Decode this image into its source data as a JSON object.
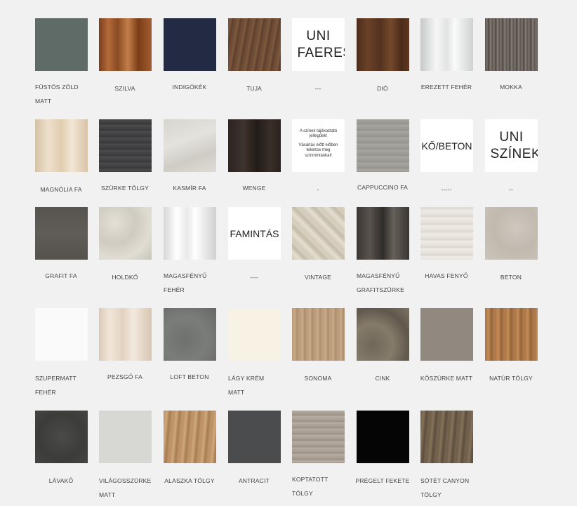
{
  "colors": {
    "page_background": "#f1f1f1",
    "caption_text": "#444444",
    "text_tile_background": "#ffffff"
  },
  "swatches": [
    {
      "label": "FÜSTÖS ZÖLD MATT"
    },
    {
      "label": "SZILVA"
    },
    {
      "label": "INDIGÓKÉK"
    },
    {
      "label": "TUJA"
    },
    {
      "tile_text": "UNI FAERES",
      "label": "---"
    },
    {
      "label": "DIÓ"
    },
    {
      "label": "EREZETT FEHÉR"
    },
    {
      "label": "MOKKA"
    },
    {
      "label": "MAGNÓLIA FA"
    },
    {
      "label": "SZÜRKE TÖLGY"
    },
    {
      "label": "KASMÍR FA"
    },
    {
      "label": "WENGE"
    },
    {
      "tile_text_1": "A színek tájékoztató jellegűek!",
      "tile_text_2": "Vásárlás előtt előben tekintse meg színmintánkat!",
      "label": "-"
    },
    {
      "label": "CAPPUCCINO FA"
    },
    {
      "tile_text": "KŐ/BETON",
      "label": "-----"
    },
    {
      "tile_text": "UNI SZÍNEK",
      "label": "--"
    },
    {
      "label": "GRAFIT FA"
    },
    {
      "label": "HOLDKŐ"
    },
    {
      "label": "MAGASFÉNYŰ FEHÉR"
    },
    {
      "tile_text": "FAMINTÁS",
      "label": "----"
    },
    {
      "label": "VINTAGE"
    },
    {
      "label": "MAGASFÉNYŰ GRAFITSZÜRKE"
    },
    {
      "label": "HAVAS FENYŐ"
    },
    {
      "label": "BETON"
    },
    {
      "label": "SZUPERMATT FEHÉR"
    },
    {
      "label": "PEZSGŐ FA"
    },
    {
      "label": "LOFT BETON"
    },
    {
      "label": "LÁGY KRÉM MATT"
    },
    {
      "label": "SONOMA"
    },
    {
      "label": "CINK"
    },
    {
      "label": "KŐSZÜRKE MATT"
    },
    {
      "label": "NATÚR TÖLGY"
    },
    {
      "label": "LÁVAKŐ"
    },
    {
      "label": "VILÁGOSSZÜRKE MATT"
    },
    {
      "label": "ALASZKA TÖLGY"
    },
    {
      "label": "ANTRACIT"
    },
    {
      "label": "KOPTATOTT TÖLGY"
    },
    {
      "label": "PRÉGELT FEKETE"
    },
    {
      "label": "SÖTÉT CANYON TÖLGY"
    }
  ]
}
